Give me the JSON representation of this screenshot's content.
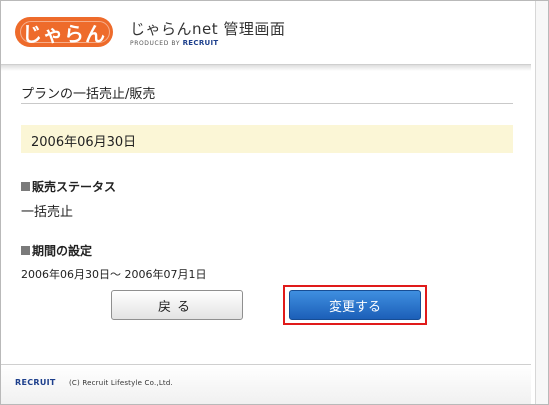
{
  "header": {
    "logo_text": "じゃらん",
    "app_title": "じゃらんnet 管理画面",
    "produced_by": "PRODUCED BY",
    "produced_brand": "RECRUIT"
  },
  "page": {
    "title": "プランの一括売止/販売",
    "date": "2006年06月30日"
  },
  "sections": {
    "status_head": "販売ステータス",
    "status_value": "一括売止",
    "period_head": "期間の設定",
    "period_value": "2006年06月30日～ 2006年07月1日"
  },
  "buttons": {
    "back": "戻る",
    "change": "変更する"
  },
  "footer": {
    "logo": "RECRUIT",
    "copyright": "(C) Recruit Lifestyle Co.,Ltd."
  },
  "colors": {
    "brand_orange": "#ee6b2b",
    "highlight_band": "#fbf6d6",
    "primary_button": "#1c5fb8",
    "annotation_red": "#e01a1a"
  }
}
